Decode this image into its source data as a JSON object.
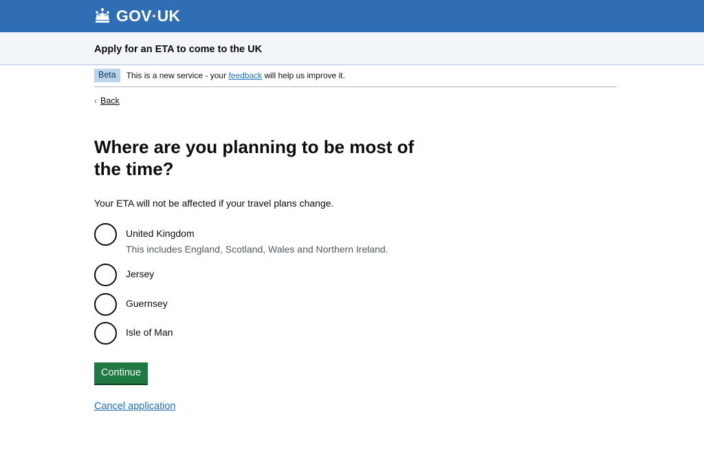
{
  "header": {
    "logo_text": "GOV·UK",
    "logo_icon": "crown-icon",
    "background_color": "#2f6db5"
  },
  "service": {
    "name": "Apply for an ETA to come to the UK"
  },
  "phase_banner": {
    "tag": "Beta",
    "text_before": "This is a new service - your ",
    "link_text": "feedback",
    "text_after": " will help us improve it."
  },
  "back_link": {
    "label": "Back",
    "icon": "chevron-left-icon"
  },
  "question": {
    "title": "Where are you planning to be most of the time?",
    "hint": "Your ETA will not be affected if your travel plans change."
  },
  "options": [
    {
      "label": "United Kingdom",
      "hint": "This includes England, Scotland, Wales and Northern Ireland.",
      "selected": false
    },
    {
      "label": "Jersey",
      "selected": false
    },
    {
      "label": "Guernsey",
      "selected": false
    },
    {
      "label": "Isle of Man",
      "selected": false
    }
  ],
  "actions": {
    "continue_label": "Continue",
    "continue_color": "#1e7a40",
    "cancel_label": "Cancel application",
    "link_color": "#1d70b8"
  }
}
